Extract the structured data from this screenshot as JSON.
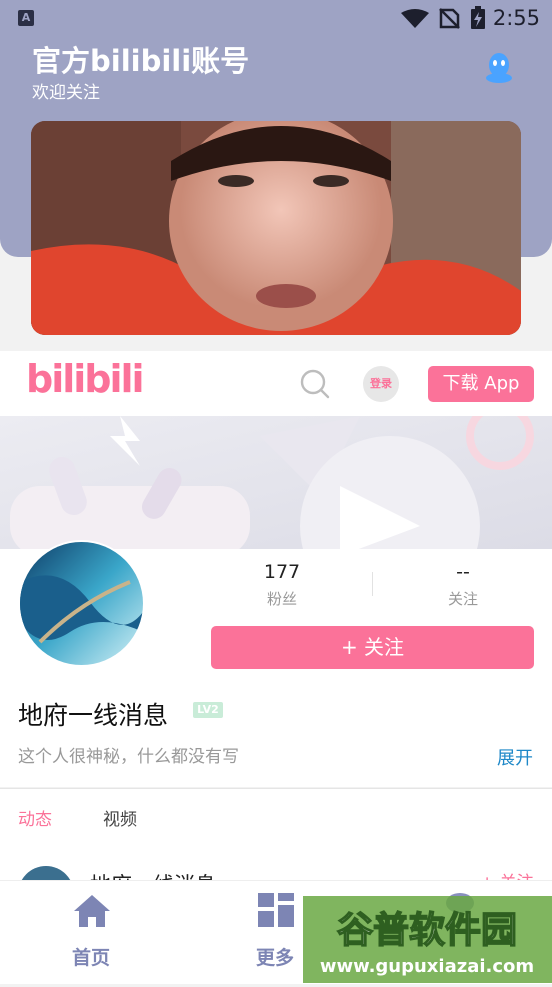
{
  "status_bar": {
    "time": "2:55",
    "app_icon_letter": "A"
  },
  "header": {
    "title": "官方bilibili账号",
    "subtitle": "欢迎关注"
  },
  "bili_bar": {
    "logo_text": "bilibili",
    "login_label": "登录",
    "download_label": "下载 App"
  },
  "profile": {
    "stats": [
      {
        "value": "177",
        "label": "粉丝"
      },
      {
        "value": "--",
        "label": "关注"
      }
    ],
    "follow_label": "+ 关注",
    "username": "地府一线消息",
    "level": "LV2",
    "bio": "这个人很神秘，什么都没有写",
    "expand_label": "展开"
  },
  "tabs": [
    {
      "label": "动态"
    },
    {
      "label": "视频"
    }
  ],
  "feed": {
    "name": "地府一线消息",
    "follow": "+ 关注"
  },
  "bottom_nav": [
    {
      "label": "首页"
    },
    {
      "label": "更多"
    }
  ],
  "watermark": {
    "title": "谷普软件园",
    "url": "www.gupuxiazai.com"
  },
  "colors": {
    "accent": "#fb7299",
    "header": "#9ea3c4",
    "nav": "#7d85b4",
    "link": "#1e88c8"
  }
}
